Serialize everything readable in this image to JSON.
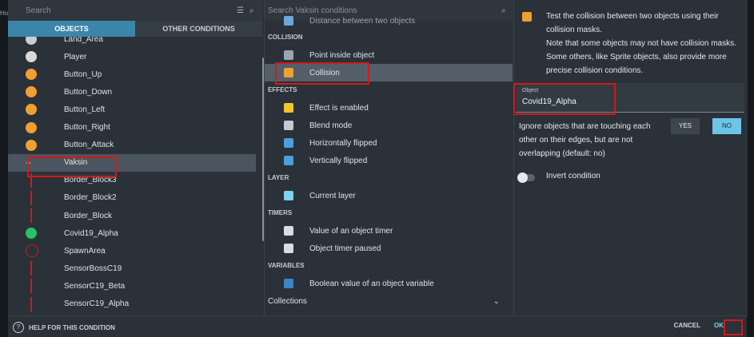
{
  "objects_panel": {
    "search_placeholder": "Search",
    "tabs": [
      "OBJECTS",
      "OTHER CONDITIONS"
    ],
    "items": [
      {
        "label": "Land_Area",
        "icon": "land-icon",
        "color": "#c9cfd4"
      },
      {
        "label": "Player",
        "icon": "player-icon",
        "color": "#d9d9d9"
      },
      {
        "label": "Button_Up",
        "icon": "button-up-icon",
        "color": "#f0a030"
      },
      {
        "label": "Button_Down",
        "icon": "button-down-icon",
        "color": "#f0a030"
      },
      {
        "label": "Button_Left",
        "icon": "button-left-icon",
        "color": "#f0a030"
      },
      {
        "label": "Button_Right",
        "icon": "button-right-icon",
        "color": "#f0a030"
      },
      {
        "label": "Button_Attack",
        "icon": "button-attack-icon",
        "color": "#f0a030"
      },
      {
        "label": "Vaksin",
        "icon": "group-minus-icon",
        "color": "#c9cfd4"
      },
      {
        "label": "Border_Block3",
        "icon": "border-icon",
        "color": "#d01a1a"
      },
      {
        "label": "Border_Block2",
        "icon": "border-icon",
        "color": "#d01a1a"
      },
      {
        "label": "Border_Block",
        "icon": "border-icon",
        "color": "#d01a1a"
      },
      {
        "label": "Covid19_Alpha",
        "icon": "virus-icon",
        "color": "#27c267"
      },
      {
        "label": "SpawnArea",
        "icon": "target-icon",
        "color": "#d01a1a"
      },
      {
        "label": "SensorBossC19",
        "icon": "sensor-icon",
        "color": "#d01a1a"
      },
      {
        "label": "SensorC19_Beta",
        "icon": "sensor-icon",
        "color": "#d01a1a"
      },
      {
        "label": "SensorC19_Alpha",
        "icon": "sensor-icon",
        "color": "#d01a1a"
      }
    ]
  },
  "conditions_panel": {
    "search_placeholder": "Search Vaksin conditions",
    "top_partial": "Distance between two objects",
    "sections": {
      "collision": "COLLISION",
      "effects": "EFFECTS",
      "layer": "LAYER",
      "timers": "TIMERS",
      "variables": "VARIABLES"
    },
    "items": {
      "point_inside": "Point inside object",
      "collision": "Collision",
      "effect_enabled": "Effect is enabled",
      "blend_mode": "Blend mode",
      "h_flipped": "Horizontally flipped",
      "v_flipped": "Vertically flipped",
      "current_layer": "Current layer",
      "timer_value": "Value of an object timer",
      "timer_paused": "Object timer paused",
      "bool_var": "Boolean value of an object variable"
    },
    "collections_label": "Collections"
  },
  "details_panel": {
    "description": "Test the collision between two objects using their collision masks.\nNote that some objects may not have collision masks. Some others, like Sprite objects, also provide more precise collision conditions.",
    "object_field": {
      "caption": "Object",
      "value": "Covid19_Alpha"
    },
    "ignore_edges_text": "Ignore objects that are touching each other on their edges, but are not overlapping (default: no)",
    "yes_label": "YES",
    "no_label": "NO",
    "invert_label": "Invert condition"
  },
  "footer": {
    "help_label": "HELP FOR THIS CONDITION",
    "cancel_label": "CANCEL",
    "ok_label": "OK"
  },
  "edge_label": "Ho",
  "colors": {
    "accent": "#3b86a8",
    "highlight": "#d01a1a",
    "primary_button": "#6ec4e6"
  }
}
